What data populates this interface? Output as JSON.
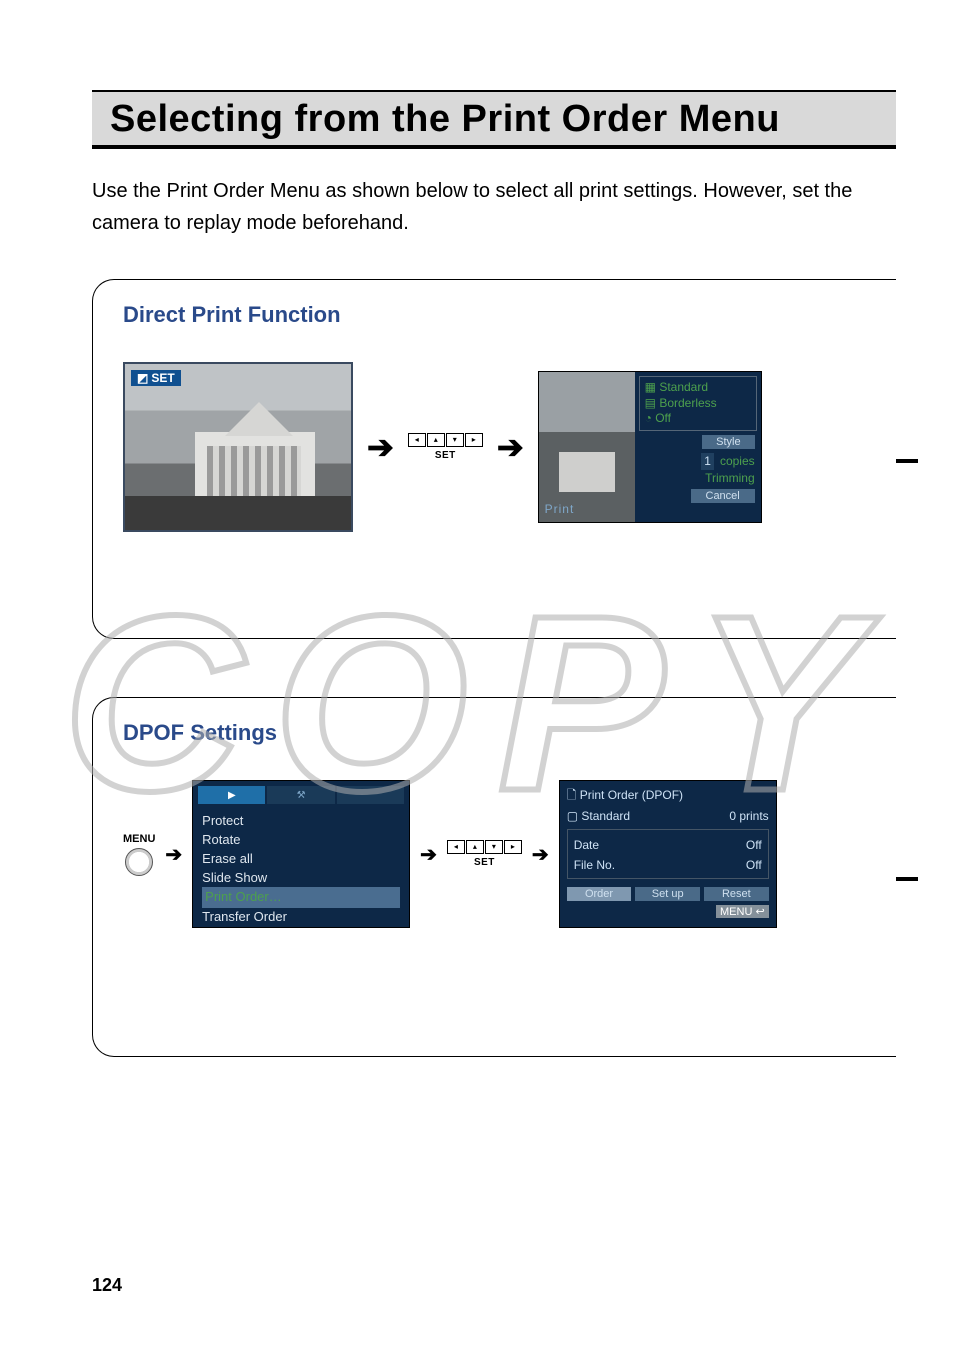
{
  "title": "Selecting from the Print Order Menu",
  "intro": "Use the Print Order Menu as shown below to select all print settings. However, set the camera to replay mode beforehand.",
  "watermark": "COPY",
  "page_number": "124",
  "panel1": {
    "heading": "Direct Print Function",
    "photo_set_label": "SET",
    "set_label": "SET",
    "screen": {
      "std": "Standard",
      "borderless": "Borderless",
      "off": "Off",
      "style_btn": "Style",
      "copies_num": "1",
      "copies_label": "copies",
      "trimming": "Trimming",
      "cancel_btn": "Cancel",
      "print_btn": "Print"
    }
  },
  "panel2": {
    "heading": "DPOF Settings",
    "menu_label": "MENU",
    "set_label": "SET",
    "playmenu": {
      "items": [
        "Protect",
        "Rotate",
        "Erase all",
        "Slide Show",
        "Print Order…",
        "Transfer Order"
      ]
    },
    "dpof": {
      "title": "Print Order (DPOF)",
      "std_label": "Standard",
      "std_value": "0 prints",
      "date_label": "Date",
      "date_value": "Off",
      "fileno_label": "File No.",
      "fileno_value": "Off",
      "btn_order": "Order",
      "btn_setup": "Set up",
      "btn_reset": "Reset",
      "menu_foot": "MENU",
      "menu_foot_icon": "↩"
    }
  }
}
